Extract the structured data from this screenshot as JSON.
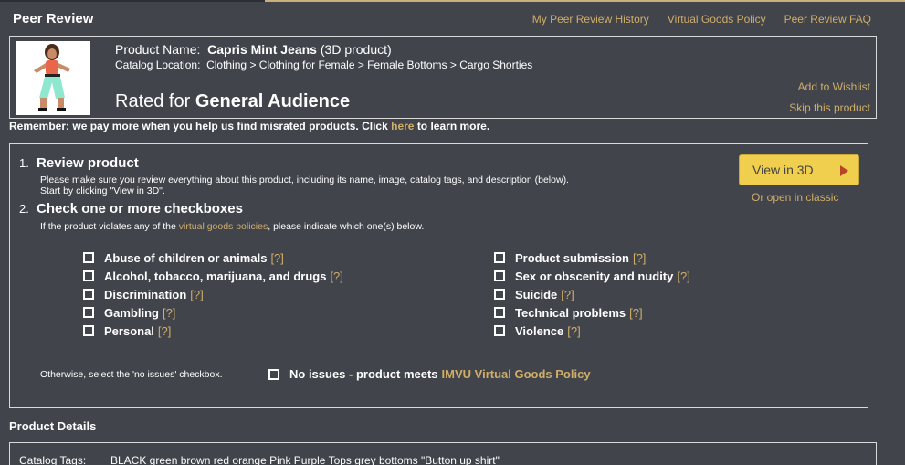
{
  "header": {
    "title": "Peer Review",
    "links": [
      "My Peer Review History",
      "Virtual Goods Policy",
      "Peer Review FAQ"
    ]
  },
  "product": {
    "name_label": "Product Name:",
    "name": "Capris Mint Jeans",
    "type": "(3D product)",
    "catalog_label": "Catalog Location:",
    "catalog_path": "Clothing > Clothing for Female > Female Bottoms > Cargo Shorties",
    "rated_prefix": "Rated for",
    "rating": "General Audience",
    "add_wishlist": "Add to Wishlist",
    "skip": "Skip this product"
  },
  "remember": {
    "text_before": "Remember: we pay more when you help us find misrated products. Click",
    "link": "here",
    "text_after": "to learn more."
  },
  "review": {
    "step1_num": "1.",
    "step1_title": "Review product",
    "step1_desc_line1": "Please make sure you review everything about this product, including its name, image, catalog tags, and description (below).",
    "step1_desc_line2": "Start by clicking \"View in 3D\".",
    "step2_num": "2.",
    "step2_title": "Check one or more checkboxes",
    "step2_desc_before": "If the product violates any of the",
    "step2_desc_link": "virtual goods policies",
    "step2_desc_after": ", please indicate which one(s) below.",
    "view3d_label": "View in 3D",
    "classic_link": "Or open in classic",
    "help_label": "[?]",
    "left_items": [
      "Abuse of children or animals",
      "Alcohol, tobacco, marijuana, and drugs",
      "Discrimination",
      "Gambling",
      "Personal"
    ],
    "right_items": [
      "Product submission",
      "Sex or obscenity and nudity",
      "Suicide",
      "Technical problems",
      "Violence"
    ],
    "otherwise_text": "Otherwise, select the 'no issues' checkbox.",
    "no_issues_text": "No issues - product meets",
    "no_issues_link": "IMVU Virtual Goods Policy"
  },
  "details": {
    "title": "Product Details",
    "tags_label": "Catalog Tags:",
    "tags_value": "BLACK green brown red orange Pink Purple Tops grey bottoms \"Button up shirt\""
  },
  "colors": {
    "background": "#42444b",
    "link": "#cfae6a",
    "button": "#f0cf4e",
    "border": "#d9d9d9"
  }
}
